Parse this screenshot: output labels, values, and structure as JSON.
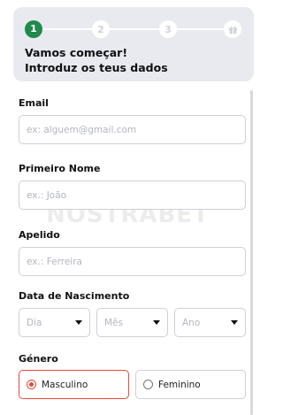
{
  "stepper": {
    "steps": [
      {
        "number": "1",
        "state": "active"
      },
      {
        "number": "2",
        "state": "inactive"
      },
      {
        "number": "3",
        "state": "inactive"
      },
      {
        "icon": "gift-icon",
        "state": "inactive"
      }
    ],
    "active_color": "#1f8a4c"
  },
  "header": {
    "title": "Vamos começar!",
    "subtitle": "Introduz os teus dados"
  },
  "form": {
    "email": {
      "label": "Email",
      "placeholder": "ex: alguem@gmail.com"
    },
    "first_name": {
      "label": "Primeiro Nome",
      "placeholder": "ex.: João"
    },
    "last_name": {
      "label": "Apelido",
      "placeholder": "ex.: Ferreira"
    },
    "birth_date": {
      "label": "Data de Nascimento",
      "day": "Dia",
      "month": "Mês",
      "year": "Ano"
    },
    "gender": {
      "label": "Género",
      "options": [
        {
          "label": "Masculino",
          "selected": true
        },
        {
          "label": "Feminino",
          "selected": false
        }
      ],
      "selected_color": "#e84a3c"
    }
  },
  "watermark": "NOSTRABET"
}
